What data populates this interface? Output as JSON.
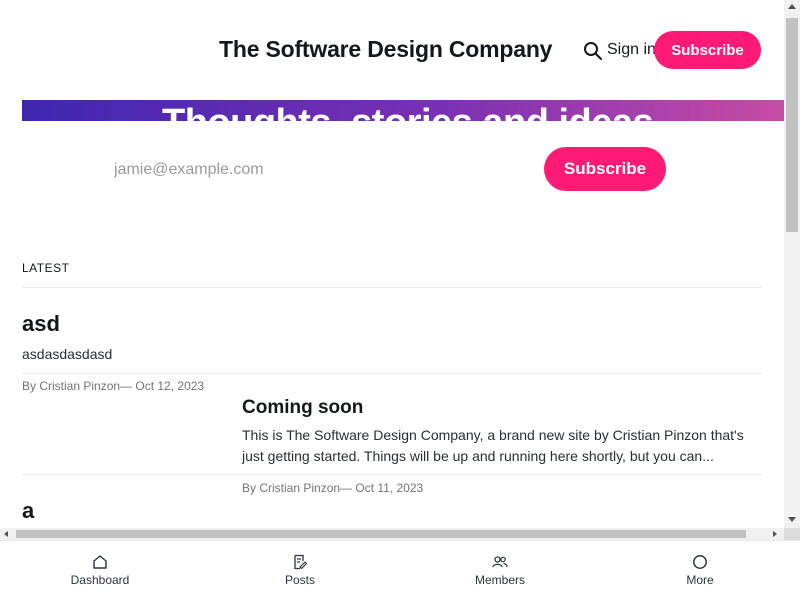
{
  "header": {
    "site_title": "The Software Design Company",
    "signin_label": "Sign in",
    "subscribe_label": "Subscribe"
  },
  "hero": {
    "title": "Thoughts, stories and ideas",
    "email_placeholder": "jamie@example.com",
    "subscribe_label": "Subscribe"
  },
  "latest": {
    "heading": "LATEST",
    "posts": [
      {
        "title": "asd",
        "excerpt": "asdasdasdasd",
        "meta": "By Cristian Pinzon— Oct 12, 2023"
      },
      {
        "title": "Coming soon",
        "excerpt": "This is The Software Design Company, a brand new site by Cristian Pinzon that's just getting started. Things will be up and running here shortly, but you can...",
        "meta": "By Cristian Pinzon— Oct 11, 2023"
      },
      {
        "title": "a"
      }
    ]
  },
  "bottom_nav": {
    "items": [
      {
        "label": "Dashboard",
        "icon": "home-icon"
      },
      {
        "label": "Posts",
        "icon": "posts-icon"
      },
      {
        "label": "Members",
        "icon": "members-icon"
      },
      {
        "label": "More",
        "icon": "more-icon"
      }
    ]
  },
  "colors": {
    "accent": "#ff1a75",
    "hero_gradient_start": "#3e27b0",
    "hero_gradient_end": "#c84ca4"
  }
}
